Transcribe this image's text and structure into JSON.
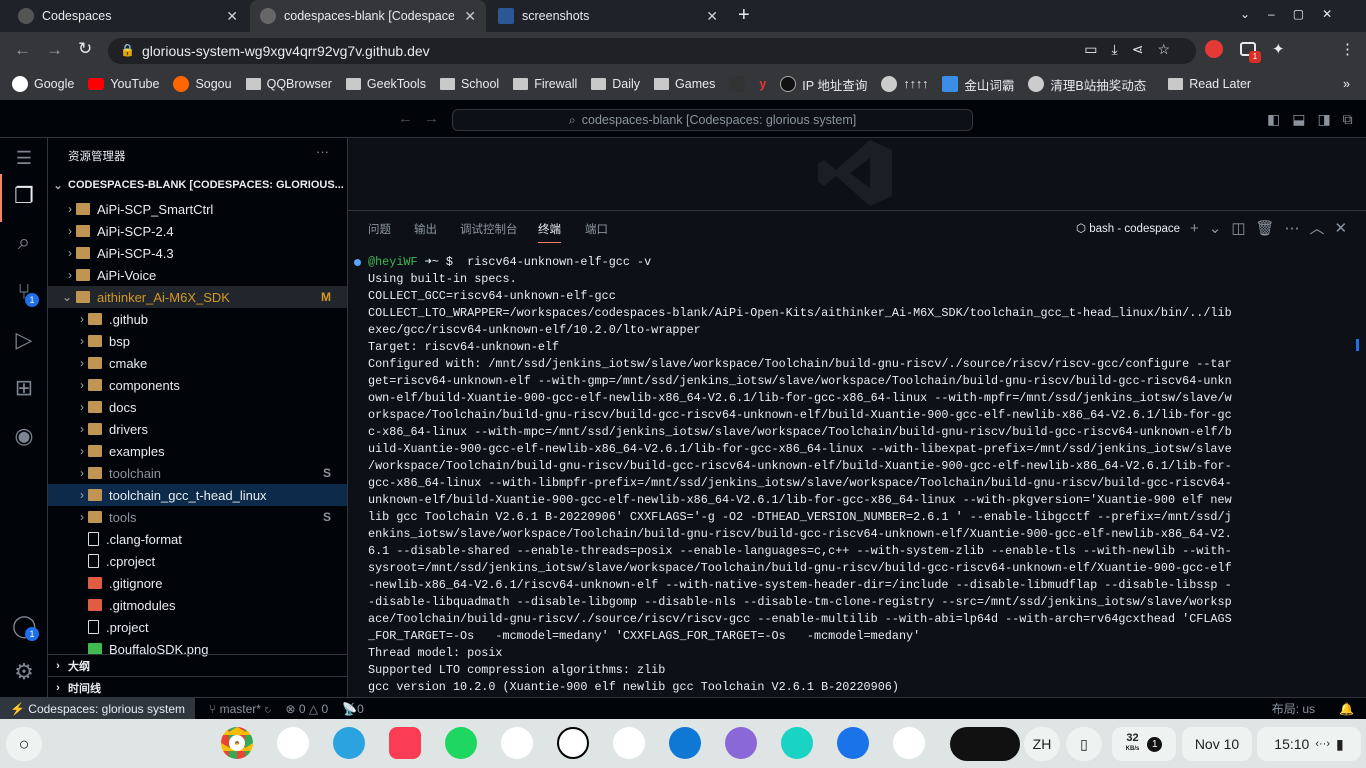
{
  "browser": {
    "tabs": [
      {
        "title": "Codespaces"
      },
      {
        "title": "codespaces-blank [Codespaces: g"
      },
      {
        "title": "screenshots"
      }
    ],
    "url": "glorious-system-wg9xgv4qrr92vg7v.github.dev",
    "extension_badge": "1",
    "bookmarks": [
      "Google",
      "YouTube",
      "Sogou",
      "QQBrowser",
      "GeekTools",
      "School",
      "Firewall",
      "Daily",
      "Games",
      "IP 地址查询",
      "↑↑↑↑",
      "金山词霸",
      "清理B站抽奖动态",
      "Read Later"
    ]
  },
  "vscode": {
    "command_center": "codespaces-blank [Codespaces: glorious system]",
    "activity_badges": {
      "scm": "1",
      "accounts": "1"
    },
    "explorer": {
      "title": "资源管理器",
      "root": "CODESPACES-BLANK [CODESPACES: GLORIOUS...",
      "items": [
        {
          "label": "AiPi-SCP_SmartCtrl",
          "depth": 1,
          "type": "folder",
          "badge": ""
        },
        {
          "label": "AiPi-SCP-2.4",
          "depth": 1,
          "type": "folder",
          "badge": ""
        },
        {
          "label": "AiPi-SCP-4.3",
          "depth": 1,
          "type": "folder",
          "badge": ""
        },
        {
          "label": "AiPi-Voice",
          "depth": 1,
          "type": "folder",
          "badge": ""
        },
        {
          "label": "aithinker_Ai-M6X_SDK",
          "depth": 1,
          "type": "folder-open",
          "badge": "M"
        },
        {
          "label": ".github",
          "depth": 2,
          "type": "folder",
          "badge": ""
        },
        {
          "label": "bsp",
          "depth": 2,
          "type": "folder",
          "badge": ""
        },
        {
          "label": "cmake",
          "depth": 2,
          "type": "folder",
          "badge": ""
        },
        {
          "label": "components",
          "depth": 2,
          "type": "folder",
          "badge": ""
        },
        {
          "label": "docs",
          "depth": 2,
          "type": "folder",
          "badge": ""
        },
        {
          "label": "drivers",
          "depth": 2,
          "type": "folder",
          "badge": ""
        },
        {
          "label": "examples",
          "depth": 2,
          "type": "folder",
          "badge": ""
        },
        {
          "label": "toolchain",
          "depth": 2,
          "type": "folder",
          "badge": "S"
        },
        {
          "label": "toolchain_gcc_t-head_linux",
          "depth": 2,
          "type": "folder",
          "badge": ""
        },
        {
          "label": "tools",
          "depth": 2,
          "type": "folder",
          "badge": "S"
        },
        {
          "label": ".clang-format",
          "depth": 2,
          "type": "file",
          "badge": ""
        },
        {
          "label": ".cproject",
          "depth": 2,
          "type": "file",
          "badge": ""
        },
        {
          "label": ".gitignore",
          "depth": 2,
          "type": "git",
          "badge": ""
        },
        {
          "label": ".gitmodules",
          "depth": 2,
          "type": "git",
          "badge": ""
        },
        {
          "label": ".project",
          "depth": 2,
          "type": "file",
          "badge": ""
        },
        {
          "label": "BouffaloSDK.png",
          "depth": 2,
          "type": "image",
          "badge": ""
        }
      ],
      "outline": "大纲",
      "timeline": "时间线"
    },
    "panel": {
      "tabs": [
        "问题",
        "输出",
        "调试控制台",
        "终端",
        "端口"
      ],
      "active_tab": "终端",
      "terminal_name": "bash - codespace",
      "prompt_user": "@heyiWF",
      "prompt_rest": " ➜~ $  riscv64-unknown-elf-gcc -v",
      "output": [
        "Using built-in specs.",
        "COLLECT_GCC=riscv64-unknown-elf-gcc",
        "COLLECT_LTO_WRAPPER=/workspaces/codespaces-blank/AiPi-Open-Kits/aithinker_Ai-M6X_SDK/toolchain_gcc_t-head_linux/bin/../lib",
        "exec/gcc/riscv64-unknown-elf/10.2.0/lto-wrapper",
        "Target: riscv64-unknown-elf",
        "Configured with: /mnt/ssd/jenkins_iotsw/slave/workspace/Toolchain/build-gnu-riscv/./source/riscv/riscv-gcc/configure --tar",
        "get=riscv64-unknown-elf --with-gmp=/mnt/ssd/jenkins_iotsw/slave/workspace/Toolchain/build-gnu-riscv/build-gcc-riscv64-unkn",
        "own-elf/build-Xuantie-900-gcc-elf-newlib-x86_64-V2.6.1/lib-for-gcc-x86_64-linux --with-mpfr=/mnt/ssd/jenkins_iotsw/slave/w",
        "orkspace/Toolchain/build-gnu-riscv/build-gcc-riscv64-unknown-elf/build-Xuantie-900-gcc-elf-newlib-x86_64-V2.6.1/lib-for-gc",
        "c-x86_64-linux --with-mpc=/mnt/ssd/jenkins_iotsw/slave/workspace/Toolchain/build-gnu-riscv/build-gcc-riscv64-unknown-elf/b",
        "uild-Xuantie-900-gcc-elf-newlib-x86_64-V2.6.1/lib-for-gcc-x86_64-linux --with-libexpat-prefix=/mnt/ssd/jenkins_iotsw/slave",
        "/workspace/Toolchain/build-gnu-riscv/build-gcc-riscv64-unknown-elf/build-Xuantie-900-gcc-elf-newlib-x86_64-V2.6.1/lib-for-",
        "gcc-x86_64-linux --with-libmpfr-prefix=/mnt/ssd/jenkins_iotsw/slave/workspace/Toolchain/build-gnu-riscv/build-gcc-riscv64-",
        "unknown-elf/build-Xuantie-900-gcc-elf-newlib-x86_64-V2.6.1/lib-for-gcc-x86_64-linux --with-pkgversion='Xuantie-900 elf new",
        "lib gcc Toolchain V2.6.1 B-20220906' CXXFLAGS='-g -O2 -DTHEAD_VERSION_NUMBER=2.6.1 ' --enable-libgcctf --prefix=/mnt/ssd/j",
        "enkins_iotsw/slave/workspace/Toolchain/build-gnu-riscv/build-gcc-riscv64-unknown-elf/Xuantie-900-gcc-elf-newlib-x86_64-V2.",
        "6.1 --disable-shared --enable-threads=posix --enable-languages=c,c++ --with-system-zlib --enable-tls --with-newlib --with-",
        "sysroot=/mnt/ssd/jenkins_iotsw/slave/workspace/Toolchain/build-gnu-riscv/build-gcc-riscv64-unknown-elf/Xuantie-900-gcc-elf",
        "-newlib-x86_64-V2.6.1/riscv64-unknown-elf --with-native-system-header-dir=/include --disable-libmudflap --disable-libssp -",
        "-disable-libquadmath --disable-libgomp --disable-nls --disable-tm-clone-registry --src=/mnt/ssd/jenkins_iotsw/slave/worksp",
        "ace/Toolchain/build-gnu-riscv/./source/riscv/riscv-gcc --enable-multilib --with-abi=lp64d --with-arch=rv64gcxthead 'CFLAGS",
        "_FOR_TARGET=-Os   -mcmodel=medany' 'CXXFLAGS_FOR_TARGET=-Os   -mcmodel=medany'",
        "Thread model: posix",
        "Supported LTO compression algorithms: zlib",
        "gcc version 10.2.0 (Xuantie-900 elf newlib gcc Toolchain V2.6.1 B-20220906)"
      ]
    },
    "status": {
      "remote": "Codespaces: glorious system",
      "branch": "master*",
      "errors": "0",
      "warnings": "0",
      "ports": "0",
      "layout": "布局: us"
    }
  },
  "taskbar": {
    "ime": "ZH",
    "net_speed": "32",
    "net_unit": "KB/s",
    "notifications": "1",
    "date": "Nov 10",
    "time": "15:10"
  },
  "colors": {
    "accent": "#1f6feb",
    "folder": "#c09553",
    "modified": "#d29922"
  }
}
